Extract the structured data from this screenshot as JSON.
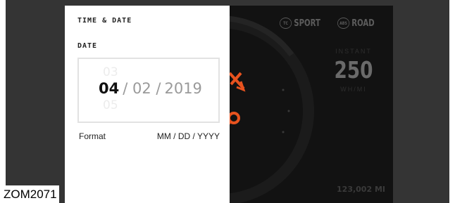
{
  "panel": {
    "title": "TIME & DATE",
    "section_label": "DATE",
    "date": {
      "month": "04",
      "day": "/ 02 /",
      "year": "2019",
      "ghost_above": "03",
      "ghost_below": "05"
    },
    "format_label": "Format",
    "format_value": "MM / DD / YYYY"
  },
  "dashboard": {
    "modes": [
      {
        "badge": "TC",
        "label": "SPORT"
      },
      {
        "badge": "ABS",
        "label": "ROAD"
      }
    ],
    "instant_label": "INSTANT",
    "power_value": "250",
    "power_unit": "WH/MI",
    "odometer": "123,002 MI",
    "accent_color": "#e8531f"
  },
  "figure_code": "ZOM2071",
  "colors": {
    "bezel": "#343434",
    "screen": "#121212",
    "panel": "#ffffff"
  }
}
